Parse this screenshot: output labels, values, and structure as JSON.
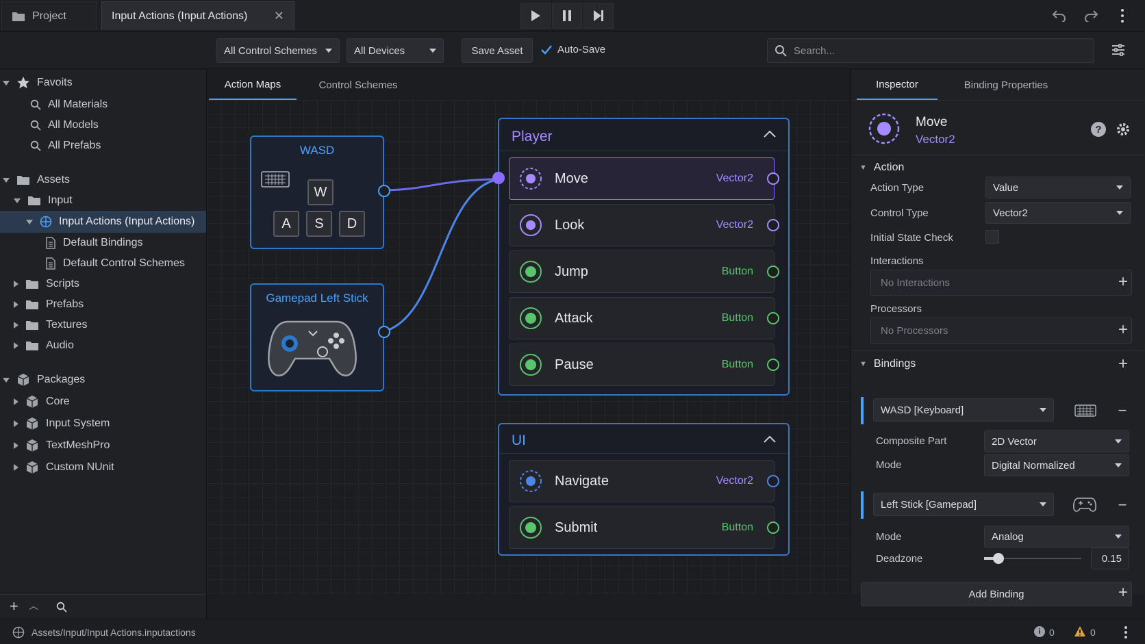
{
  "titlebar": {
    "tab_project": "Project",
    "tab_input": "Input Actions (Input Actions)"
  },
  "toolbar": {
    "control_schemes": "All Control Schemes",
    "devices": "All Devices",
    "save_asset": "Save Asset",
    "auto_save": "Auto-Save",
    "search_placeholder": "Search..."
  },
  "sidebar": {
    "favorites": "Favoits",
    "fav_items": [
      "All Materials",
      "All Models",
      "All Prefabs"
    ],
    "assets": "Assets",
    "input": "Input",
    "input_actions": "Input Actions (Input Actions)",
    "default_bindings": "Default Bindings",
    "default_control_schemes": "Default Control Schemes",
    "folders": [
      "Scripts",
      "Prefabs",
      "Textures",
      "Audio"
    ],
    "packages": "Packages",
    "package_items": [
      "Core",
      "Input System",
      "TextMeshPro",
      "Custom NUnit"
    ]
  },
  "center": {
    "tab_action_maps": "Action Maps",
    "tab_control_schemes": "Control Schemes",
    "node_wasd": "WASD",
    "keys": [
      "W",
      "A",
      "S",
      "D"
    ],
    "node_gamepad": "Gamepad Left Stick",
    "player": {
      "title": "Player",
      "actions": [
        {
          "name": "Move",
          "type": "Vector2"
        },
        {
          "name": "Look",
          "type": "Vector2"
        },
        {
          "name": "Jump",
          "type": "Button"
        },
        {
          "name": "Attack",
          "type": "Button"
        },
        {
          "name": "Pause",
          "type": "Button"
        }
      ]
    },
    "ui": {
      "title": "UI",
      "actions": [
        {
          "name": "Navigate",
          "type": "Vector2"
        },
        {
          "name": "Submit",
          "type": "Button"
        }
      ]
    }
  },
  "inspector": {
    "tab_inspector": "Inspector",
    "tab_binding_props": "Binding Properties",
    "action_name": "Move",
    "action_type_label": "Vector2",
    "section_action": "Action",
    "action_type": "Action Type",
    "action_type_value": "Value",
    "control_type": "Control Type",
    "control_type_value": "Vector2",
    "initial_state_check": "Initial State Check",
    "interactions": "Interactions",
    "no_interactions": "No Interactions",
    "processors": "Processors",
    "no_processors": "No Processors",
    "section_bindings": "Bindings",
    "binding1": "WASD [Keyboard]",
    "composite_part": "Composite Part",
    "composite_part_value": "2D Vector",
    "mode": "Mode",
    "mode1_value": "Digital Normalized",
    "binding2": "Left Stick [Gamepad]",
    "mode2_value": "Analog",
    "deadzone": "Deadzone",
    "deadzone_value": "0.15",
    "deadzone_fraction": 0.15,
    "add_binding": "Add Binding"
  },
  "status": {
    "path": "Assets/Input/Input Actions.inputactions",
    "info_count": "0",
    "warn_count": "0"
  },
  "colors": {
    "accent_blue": "#4aa2ff",
    "purple": "#a58bff",
    "green": "#59c46a"
  }
}
